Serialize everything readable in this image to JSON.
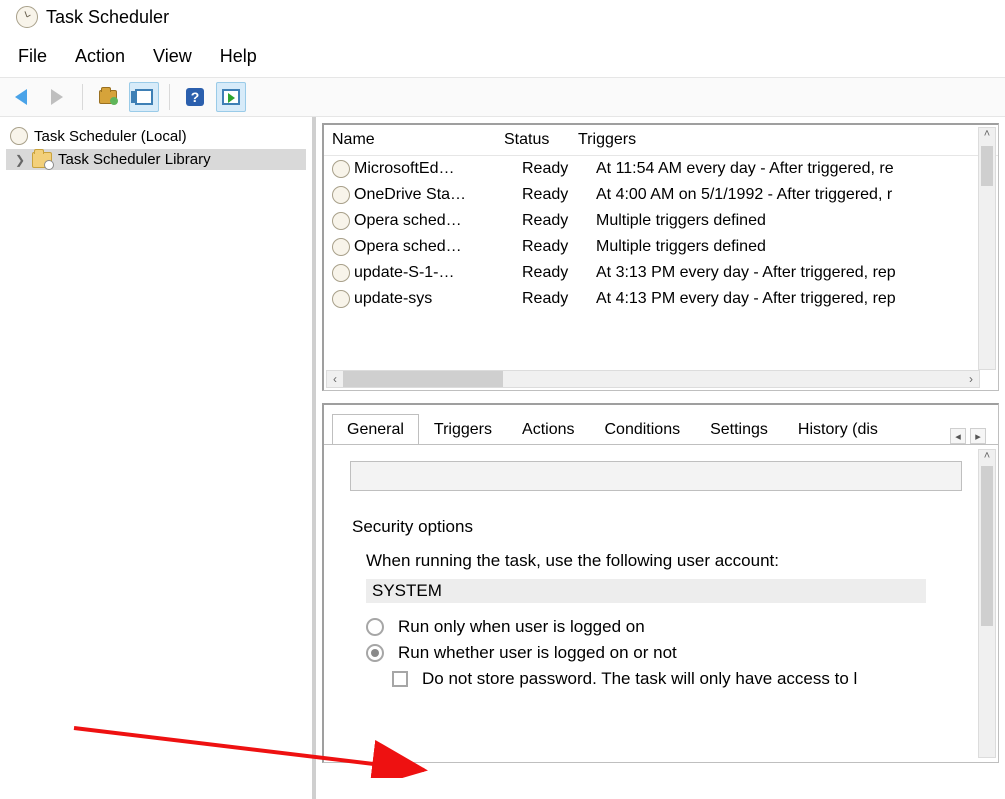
{
  "window": {
    "title": "Task Scheduler"
  },
  "menu": {
    "file": "File",
    "action": "Action",
    "view": "View",
    "help": "Help"
  },
  "tree": {
    "root": "Task Scheduler (Local)",
    "library": "Task Scheduler Library"
  },
  "task_list": {
    "headers": {
      "name": "Name",
      "status": "Status",
      "triggers": "Triggers"
    },
    "rows": [
      {
        "name": "MicrosoftEd…",
        "status": "Ready",
        "triggers": "At 11:54 AM every day - After triggered, re"
      },
      {
        "name": "OneDrive Sta…",
        "status": "Ready",
        "triggers": "At 4:00 AM on 5/1/1992 - After triggered, r"
      },
      {
        "name": "Opera sched…",
        "status": "Ready",
        "triggers": "Multiple triggers defined"
      },
      {
        "name": "Opera sched…",
        "status": "Ready",
        "triggers": "Multiple triggers defined"
      },
      {
        "name": "update-S-1-…",
        "status": "Ready",
        "triggers": "At 3:13 PM every day - After triggered, rep"
      },
      {
        "name": "update-sys",
        "status": "Ready",
        "triggers": "At 4:13 PM every day - After triggered, rep"
      }
    ]
  },
  "tabs": {
    "general": "General",
    "triggers": "Triggers",
    "actions": "Actions",
    "conditions": "Conditions",
    "settings": "Settings",
    "history": "History (dis"
  },
  "general_tab": {
    "security_options_title": "Security options",
    "run_as_label": "When running the task, use the following user account:",
    "user": "SYSTEM",
    "radio_logged_on": "Run only when user is logged on",
    "radio_logged_or_not": "Run whether user is logged on or not",
    "checkbox_no_password": "Do not store password.  The task will only have access to l"
  }
}
